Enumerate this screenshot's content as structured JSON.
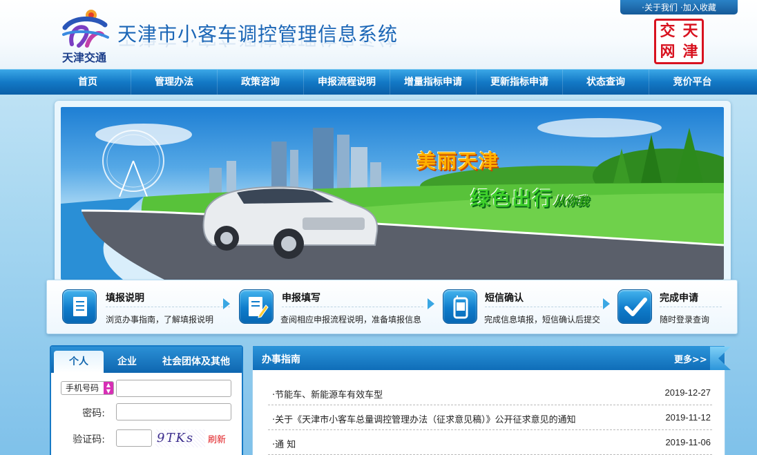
{
  "header": {
    "logo_text": "天津交通",
    "title": "天津市小客车调控管理信息系统",
    "about_link": "·关于我们",
    "bookmark_link": "·加入收藏",
    "seal_chars": [
      "天",
      "津",
      "交",
      "网"
    ]
  },
  "nav": {
    "items": [
      "首页",
      "管理办法",
      "政策咨询",
      "申报流程说明",
      "增量指标申请",
      "更新指标申请",
      "状态查询",
      "竞价平台"
    ]
  },
  "banner": {
    "slogan1": "美丽天津",
    "slogan2": "绿色出行",
    "slogan2_small": "从你我"
  },
  "steps": [
    {
      "title": "填报说明",
      "desc": "浏览办事指南，了解填报说明",
      "icon": "document-icon"
    },
    {
      "title": "申报填写",
      "desc": "查阅相应申报流程说明，准备填报信息",
      "icon": "form-edit-icon"
    },
    {
      "title": "短信确认",
      "desc": "完成信息填报，短信确认后提交",
      "icon": "mobile-phone-icon"
    },
    {
      "title": "完成申请",
      "desc": "随时登录查询",
      "icon": "checkmark-icon"
    }
  ],
  "login": {
    "tabs": [
      "个人",
      "企业",
      "社会团体及其他"
    ],
    "active_tab": "个人",
    "id_type": "手机号码",
    "password_label": "密码:",
    "captcha_label": "验证码:",
    "captcha_text": "9TKs",
    "refresh_label": "刷新"
  },
  "guide": {
    "title": "办事指南",
    "more": "更多>>",
    "items": [
      {
        "title": "·节能车、新能源车有效车型",
        "date": "2019-12-27"
      },
      {
        "title": "·关于《天津市小客车总量调控管理办法（征求意见稿）》公开征求意见的通知",
        "date": "2019-11-12"
      },
      {
        "title": "·通 知",
        "date": "2019-11-06"
      }
    ]
  },
  "colors": {
    "nav_blue": "#1379c6",
    "title_blue": "#1b66b6",
    "seal_red": "#d8121f",
    "refresh_red": "#e0191d"
  }
}
